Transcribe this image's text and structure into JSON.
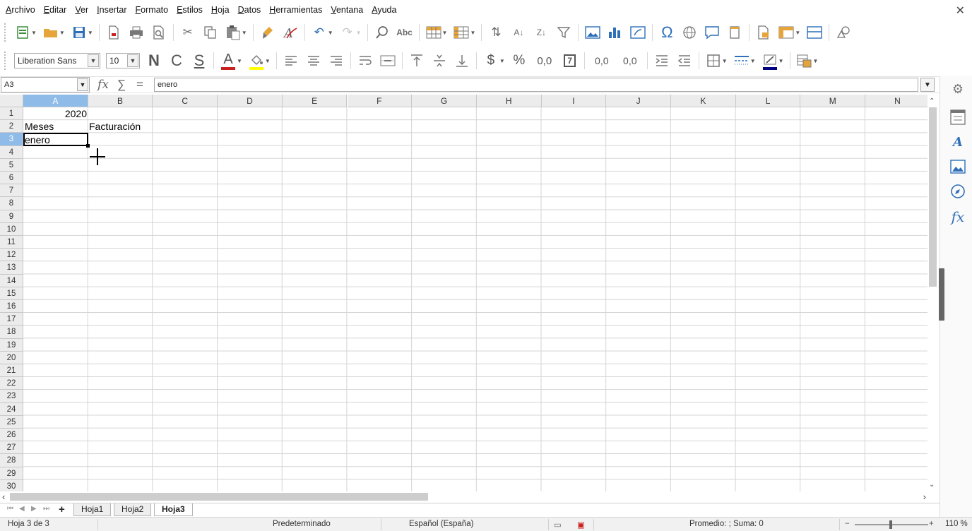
{
  "menu": [
    "Archivo",
    "Editar",
    "Ver",
    "Insertar",
    "Formato",
    "Estilos",
    "Hoja",
    "Datos",
    "Herramientas",
    "Ventana",
    "Ayuda"
  ],
  "close_glyph": "✕",
  "font": {
    "name": "Liberation Sans",
    "size": "10"
  },
  "format_buttons": {
    "bold": "N",
    "italic": "C",
    "underline": "S",
    "font_color_letter": "A",
    "currency": "$",
    "percent": "%",
    "number": "0,0",
    "date": "7",
    "add_decimal": "0,0",
    "del_decimal": "0,0"
  },
  "colors": {
    "font_color": "#c9211e",
    "highlight": "#ffff00",
    "line_color": "#000080",
    "selection_header": "#8fbbe8",
    "accent": "#2f6fb8"
  },
  "namebox": {
    "value": "A3"
  },
  "formula": {
    "fx": "fx",
    "sum": "∑",
    "equals": "=",
    "content": "enero"
  },
  "columns": [
    "A",
    "B",
    "C",
    "D",
    "E",
    "F",
    "G",
    "H",
    "I",
    "J",
    "K",
    "L",
    "M",
    "N"
  ],
  "active_column": "A",
  "rows": [
    "1",
    "2",
    "3",
    "4",
    "5",
    "6",
    "7",
    "8",
    "9",
    "10",
    "11",
    "12",
    "13",
    "14",
    "15",
    "16",
    "17",
    "18",
    "19",
    "20",
    "21",
    "22",
    "23",
    "24",
    "25",
    "26",
    "27",
    "28",
    "29",
    "30"
  ],
  "active_row": "3",
  "cells": {
    "a1": "2020",
    "a2": "Meses",
    "b2": "Facturación",
    "a3": "enero"
  },
  "sheet_tabs": [
    "Hoja1",
    "Hoja2",
    "Hoja3"
  ],
  "active_sheet": "Hoja3",
  "add_sheet": "+",
  "status": {
    "sheet": "Hoja 3 de 3",
    "style": "Predeterminado",
    "language": "Español (España)",
    "summary": "Promedio: ; Suma: 0",
    "zoom": "110 %"
  },
  "icons": {
    "toolbar1": [
      "new-icon",
      "open-icon",
      "save-icon",
      "export-pdf-icon",
      "print-icon",
      "print-preview-icon",
      "cut-icon",
      "copy-icon",
      "paste-icon",
      "clone-formatting-icon",
      "clear-formatting-icon",
      "undo-icon",
      "redo-icon",
      "find-replace-icon",
      "spelling-icon",
      "row-icon",
      "column-icon",
      "sort-icon",
      "sort-ascending-icon",
      "sort-descending-icon",
      "autofilter-icon",
      "image-icon",
      "chart-icon",
      "pivot-table-icon",
      "special-character-icon",
      "hyperlink-icon",
      "comment-icon",
      "header-footer-icon",
      "define-print-area-icon",
      "freeze-rows-columns-icon",
      "split-window-icon",
      "show-draw-functions-icon"
    ],
    "sidebar": [
      "properties-icon",
      "styles-icon",
      "gallery-icon",
      "navigator-icon",
      "functions-icon",
      "settings-icon"
    ]
  }
}
